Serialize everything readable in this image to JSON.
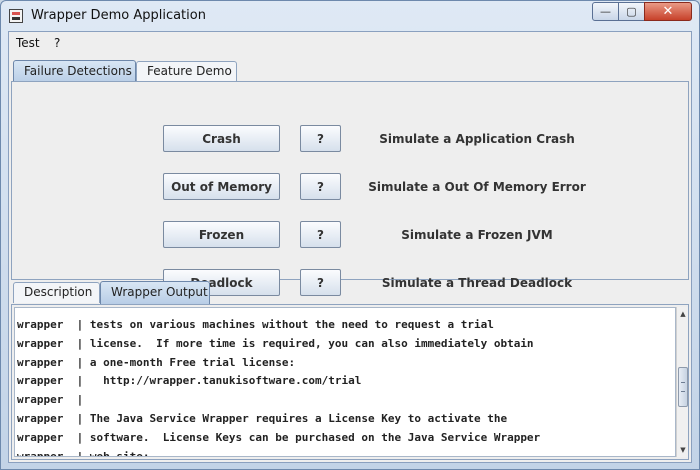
{
  "window": {
    "title": "Wrapper Demo Application",
    "controls": {
      "minimize": "—",
      "maximize": "▢",
      "close": "✕"
    }
  },
  "menu": {
    "items": [
      "Test",
      "?"
    ]
  },
  "top_tabs": [
    {
      "label": "Failure Detections",
      "selected": true
    },
    {
      "label": "Feature Demo",
      "selected": false
    }
  ],
  "failure_actions": [
    {
      "label": "Crash",
      "help": "?",
      "description": "Simulate a Application Crash"
    },
    {
      "label": "Out of Memory",
      "help": "?",
      "description": "Simulate a Out Of Memory Error"
    },
    {
      "label": "Frozen",
      "help": "?",
      "description": "Simulate a Frozen JVM"
    },
    {
      "label": "Deadlock",
      "help": "?",
      "description": "Simulate a Thread Deadlock"
    }
  ],
  "bottom_tabs": [
    {
      "label": "Description",
      "selected": false
    },
    {
      "label": "Wrapper Output",
      "selected": true
    }
  ],
  "output": {
    "lines": [
      "wrapper  | tests on various machines without the need to request a trial",
      "wrapper  | license.  If more time is required, you can also immediately obtain",
      "wrapper  | a one-month Free trial license:",
      "wrapper  |   http://wrapper.tanukisoftware.com/trial",
      "wrapper  |",
      "wrapper  | The Java Service Wrapper requires a License Key to activate the",
      "wrapper  | software.  License Keys can be purchased on the Java Service Wrapper",
      "wrapper  | web site:"
    ]
  },
  "scrollbar": {
    "up_arrow": "▲",
    "down_arrow": "▼"
  },
  "colors": {
    "title_bar": "#dfe9f5",
    "selected_tab": "#b8cde6",
    "close_button": "#c7412a",
    "panel_background": "#eeeeee"
  }
}
